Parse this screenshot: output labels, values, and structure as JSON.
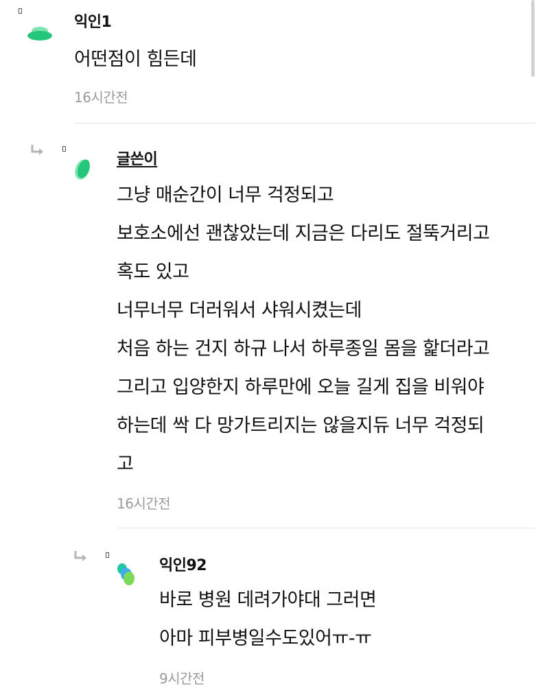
{
  "comments": [
    {
      "author": "익인1",
      "lines": [
        "어떤점이 힘든데"
      ],
      "time": "16시간전"
    },
    {
      "author": "글쓴이",
      "lines": [
        "그냥 매순간이 너무 걱정되고",
        "보호소에선 괜찮았는데 지금은 다리도 절뚝거리고",
        "혹도 있고",
        "너무너무 더러워서 샤워시켰는데",
        "처음 하는 건지 하규 나서 하루종일 몸을 핥더라고",
        "그리고 입양한지 하루만에 오늘 길게 집을 비워야",
        "하는데 싹 다 망가트리지는 않을지듀 너무 걱정되",
        "고"
      ],
      "time": "16시간전"
    },
    {
      "author": "익인92",
      "lines": [
        "바로 병원 데려가야대 그러면",
        "아마 피부병일수도있어ㅠ-ㅠ"
      ],
      "time": "9시간전"
    }
  ],
  "icons": {
    "avatar": "avatar-blob-icon",
    "reply": "reply-arrow-icon"
  },
  "colors": {
    "accent_green": "#2ed47a",
    "accent_teal": "#21c7a8",
    "accent_blue": "#3fa9f5",
    "time_gray": "#9a9a9a",
    "divider": "#e6e6e6"
  }
}
